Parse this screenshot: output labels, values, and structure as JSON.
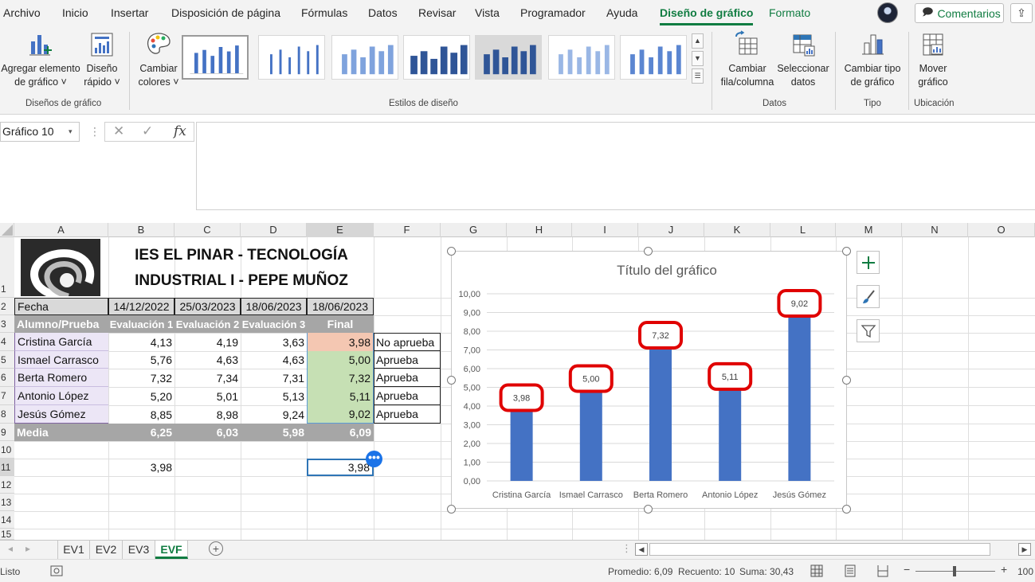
{
  "menu": {
    "tabs": [
      "Archivo",
      "Inicio",
      "Insertar",
      "Disposición de página",
      "Fórmulas",
      "Datos",
      "Revisar",
      "Vista",
      "Programador",
      "Ayuda",
      "Diseño de gráfico",
      "Formato"
    ],
    "comments_label": "Comentarios"
  },
  "ribbon": {
    "add_element": [
      "Agregar elemento",
      "de gráfico ˅"
    ],
    "quick_layout": [
      "Diseño",
      "rápido ˅"
    ],
    "change_colors": [
      "Cambiar",
      "colores ˅"
    ],
    "switch_row_col": [
      "Cambiar",
      "fila/columna"
    ],
    "select_data": [
      "Seleccionar",
      "datos"
    ],
    "change_type": [
      "Cambiar tipo",
      "de gráfico"
    ],
    "move_chart": [
      "Mover",
      "gráfico"
    ],
    "groups": {
      "chart_layouts": "Diseños de gráfico",
      "chart_styles": "Estilos de diseño",
      "data": "Datos",
      "type": "Tipo",
      "location": "Ubicación"
    }
  },
  "formula_bar": {
    "name_box": "Gráfico 10",
    "formula": ""
  },
  "columns": [
    "A",
    "B",
    "C",
    "D",
    "E",
    "F",
    "G",
    "H",
    "I",
    "J",
    "K",
    "L",
    "M",
    "N",
    "O"
  ],
  "rows": [
    "1",
    "2",
    "3",
    "4",
    "5",
    "6",
    "7",
    "8",
    "9",
    "10",
    "11",
    "12",
    "13",
    "14",
    "15"
  ],
  "sheet": {
    "title_line1": "IES EL PINAR - TECNOLOGÍA",
    "title_line2": "INDUSTRIAL I - PEPE MUÑOZ",
    "date_label": "Fecha",
    "dates": [
      "14/12/2022",
      "25/03/2023",
      "18/06/2023",
      "18/06/2023"
    ],
    "header": [
      "Alumno/Prueba",
      "Evaluación 1",
      "Evaluación 2",
      "Evaluación 3",
      "Final"
    ],
    "students": [
      {
        "name": "Cristina García",
        "e1": "4,13",
        "e2": "4,19",
        "e3": "3,63",
        "final": "3,98",
        "status": "No aprueba"
      },
      {
        "name": "Ismael Carrasco",
        "e1": "5,76",
        "e2": "4,63",
        "e3": "4,63",
        "final": "5,00",
        "status": "Aprueba"
      },
      {
        "name": "Berta Romero",
        "e1": "7,32",
        "e2": "7,34",
        "e3": "7,31",
        "final": "7,32",
        "status": "Aprueba"
      },
      {
        "name": "Antonio López",
        "e1": "5,20",
        "e2": "5,01",
        "e3": "5,13",
        "final": "5,11",
        "status": "Aprueba"
      },
      {
        "name": "Jesús Gómez",
        "e1": "8,85",
        "e2": "8,98",
        "e3": "9,24",
        "final": "9,02",
        "status": "Aprueba"
      }
    ],
    "media": {
      "label": "Media",
      "e1": "6,25",
      "e2": "6,03",
      "e3": "5,98",
      "final": "6,09"
    },
    "b11": "3,98",
    "e11": "3,98"
  },
  "chart_data": {
    "type": "bar",
    "title": "Título del gráfico",
    "categories": [
      "Cristina García",
      "Ismael Carrasco",
      "Berta Romero",
      "Antonio López",
      "Jesús Gómez"
    ],
    "values": [
      3.98,
      5.0,
      7.32,
      5.11,
      9.02
    ],
    "value_labels": [
      "3,98",
      "5,00",
      "7,32",
      "5,11",
      "9,02"
    ],
    "ylim": [
      0,
      10
    ],
    "y_ticks": [
      "0,00",
      "1,00",
      "2,00",
      "3,00",
      "4,00",
      "5,00",
      "6,00",
      "7,00",
      "8,00",
      "9,00",
      "10,00"
    ],
    "xlabel": "",
    "ylabel": "",
    "bar_color": "#4472c4",
    "label_highlight_color": "#e00000",
    "grid": true,
    "legend": "none"
  },
  "sheet_tabs": [
    "EV1",
    "EV2",
    "EV3",
    "EVF"
  ],
  "active_tab": "EVF",
  "status": {
    "ready": "Listo",
    "average": "Promedio: 6,09",
    "count": "Recuento: 10",
    "sum": "Suma: 30,43",
    "zoom": "100"
  },
  "colors": {
    "accent": "#107c41",
    "header_fill": "#a6a6a6",
    "name_fill": "#ece6f6",
    "fail_fill": "#f4c7b2",
    "pass_fill": "#c6e0b4"
  }
}
